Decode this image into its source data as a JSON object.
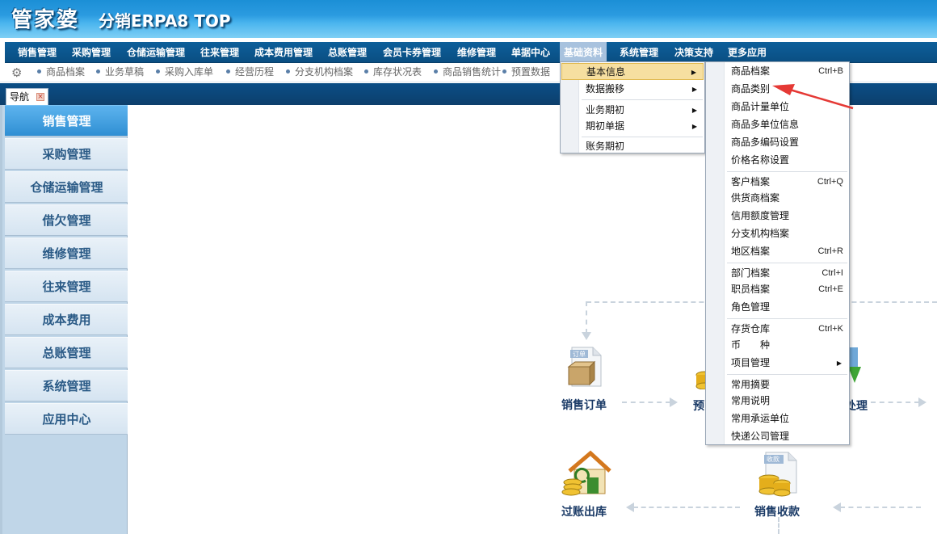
{
  "header": {
    "logo_main": "管家婆",
    "logo_sub": "分销ERPA8 TOP"
  },
  "main_menu": [
    {
      "label": "销售管理",
      "active": false
    },
    {
      "label": "采购管理",
      "active": false
    },
    {
      "label": "仓储运输管理",
      "active": false
    },
    {
      "label": "往来管理",
      "active": false
    },
    {
      "label": "成本费用管理",
      "active": false
    },
    {
      "label": "总账管理",
      "active": false
    },
    {
      "label": "会员卡券管理",
      "active": false
    },
    {
      "label": "维修管理",
      "active": false
    },
    {
      "label": "单据中心",
      "active": false
    },
    {
      "label": "基础资料",
      "active": true
    },
    {
      "label": "系统管理",
      "active": false
    },
    {
      "label": "决策支持",
      "active": false
    },
    {
      "label": "更多应用",
      "active": false
    }
  ],
  "quick_links": [
    "商品档案",
    "业务草稿",
    "采购入库单",
    "经营历程",
    "分支机构档案",
    "库存状况表",
    "商品销售统计",
    "预置数据"
  ],
  "tab": {
    "label": "导航",
    "close_glyph": "×"
  },
  "sidebar": [
    {
      "label": "销售管理",
      "active": true
    },
    {
      "label": "采购管理",
      "active": false
    },
    {
      "label": "仓储运输管理",
      "active": false
    },
    {
      "label": "借欠管理",
      "active": false
    },
    {
      "label": "维修管理",
      "active": false
    },
    {
      "label": "往来管理",
      "active": false
    },
    {
      "label": "成本费用",
      "active": false
    },
    {
      "label": "总账管理",
      "active": false
    },
    {
      "label": "系统管理",
      "active": false
    },
    {
      "label": "应用中心",
      "active": false
    }
  ],
  "flow": {
    "sales_order": "销售订单",
    "pre_partial": "预",
    "process_partial": "处理",
    "post_out": "过账出库",
    "sales_receipt": "销售收款",
    "order_doc_tag": "订单",
    "receipt_doc_tag": "收款"
  },
  "dropdown_level1": [
    {
      "label": "基本信息",
      "submenu": true,
      "highlight": true
    },
    {
      "label": "数据搬移",
      "submenu": true
    },
    {
      "label": "业务期初",
      "submenu": true
    },
    {
      "label": "期初单据",
      "submenu": true
    },
    {
      "label": "账务期初",
      "submenu": false
    }
  ],
  "dropdown_level2": [
    {
      "label": "商品档案",
      "shortcut": "Ctrl+B"
    },
    {
      "label": "商品类别",
      "shortcut": ""
    },
    {
      "label": "商品计量单位",
      "shortcut": ""
    },
    {
      "label": "商品多单位信息",
      "shortcut": ""
    },
    {
      "label": "商品多编码设置",
      "shortcut": ""
    },
    {
      "label": "价格名称设置",
      "shortcut": ""
    },
    {
      "label": "客户档案",
      "shortcut": "Ctrl+Q"
    },
    {
      "label": "供货商档案",
      "shortcut": ""
    },
    {
      "label": "信用额度管理",
      "shortcut": ""
    },
    {
      "label": "分支机构档案",
      "shortcut": ""
    },
    {
      "label": "地区档案",
      "shortcut": "Ctrl+R"
    },
    {
      "label": "部门档案",
      "shortcut": "Ctrl+I"
    },
    {
      "label": "职员档案",
      "shortcut": "Ctrl+E"
    },
    {
      "label": "角色管理",
      "shortcut": ""
    },
    {
      "label": "存货仓库",
      "shortcut": "Ctrl+K"
    },
    {
      "label": "币　　种",
      "shortcut": ""
    },
    {
      "label": "项目管理",
      "shortcut": "",
      "submenu": true
    },
    {
      "label": "常用摘要",
      "shortcut": ""
    },
    {
      "label": "常用说明",
      "shortcut": ""
    },
    {
      "label": "常用承运单位",
      "shortcut": ""
    },
    {
      "label": "快递公司管理",
      "shortcut": ""
    }
  ],
  "colors": {
    "header_blue": "#2b9be0",
    "menubar_blue": "#0d5f9a",
    "sidebar_active": "#3b9ee0",
    "highlight": "#f6dfa0",
    "annotation_arrow": "#e53935"
  }
}
